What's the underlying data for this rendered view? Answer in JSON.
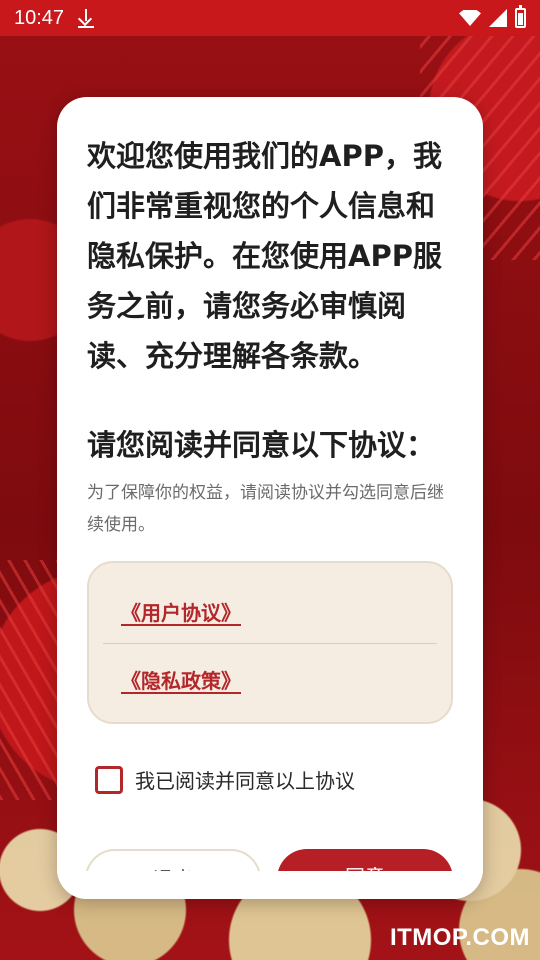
{
  "status_bar": {
    "time": "10:47",
    "icons": [
      "download-icon",
      "wifi-icon",
      "signal-icon",
      "battery-icon"
    ]
  },
  "dialog": {
    "intro": "欢迎您使用我们的APP，我们非常重视您的个人信息和隐私保护。在您使用APP服务之前，请您务必审慎阅读、充分理解各条款。",
    "section_title": "请您阅读并同意以下协议：",
    "section_desc": "为了保障你的权益，请阅读协议并勾选同意后继续使用。",
    "agreements": [
      {
        "label": "《用户协议》"
      },
      {
        "label": "《隐私政策》"
      }
    ],
    "consent_label": "我已阅读并同意以上协议",
    "consent_checked": false,
    "buttons": {
      "exit": "退出",
      "agree": "同意"
    }
  },
  "watermark": "ITMOP.COM",
  "colors": {
    "status_bar": "#c8181c",
    "accent": "#b51f25",
    "link": "#b3262a",
    "agreements_bg": "#f5ede2"
  }
}
